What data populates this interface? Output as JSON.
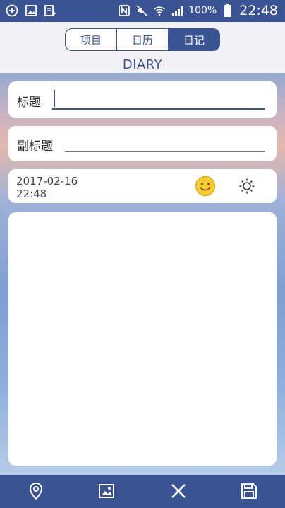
{
  "status_bar": {
    "icons": [
      "add-circle-icon",
      "image-icon",
      "download-icon",
      "nfc-icon",
      "mute-icon",
      "wifi-icon",
      "signal-icon",
      "battery-icon"
    ],
    "battery_percent": "100%",
    "time": "22:48"
  },
  "header": {
    "tabs": [
      {
        "label": "项目",
        "active": false
      },
      {
        "label": "日历",
        "active": false
      },
      {
        "label": "日记",
        "active": true
      }
    ],
    "title": "DIARY"
  },
  "form": {
    "title_label": "标题",
    "title_value": "",
    "subtitle_label": "副标题",
    "subtitle_value": "",
    "date": "2017-02-16",
    "time": "22:48",
    "mood_icon": "smiley-icon",
    "weather_icon": "sun-icon",
    "body_value": ""
  },
  "bottom_bar": {
    "icons": [
      "location-icon",
      "image-icon",
      "close-icon",
      "save-icon"
    ]
  },
  "colors": {
    "primary": "#3a5392",
    "header_bg": "#f2f2f4",
    "card_bg": "#ffffff",
    "mood_yellow": "#f7cc2e"
  }
}
